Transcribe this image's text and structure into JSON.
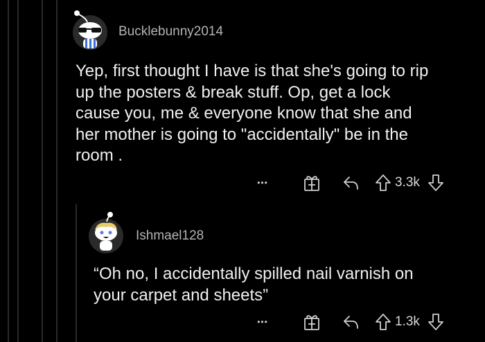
{
  "comments": [
    {
      "username": "Bucklebunny2014",
      "body": "Yep, first thought I have is that she's going to rip\nup the posters & break stuff. Op, get a lock\ncause you, me & everyone know that she and\nher mother is going to \"accidentally\" be in the\nroom .",
      "more_label": "•••",
      "vote_count": "3.3k"
    },
    {
      "username": "Ishmael128",
      "body": "“Oh no, I accidentally spilled nail varnish on\nyour carpet and sheets”",
      "more_label": "•••",
      "vote_count": "1.3k"
    }
  ],
  "icons": [
    "more-options-icon",
    "award-gift-icon",
    "reply-icon",
    "upvote-icon",
    "downvote-icon"
  ],
  "colors": {
    "background": "#000000",
    "text": "#f0f0f0",
    "muted": "#b4b4b4",
    "thread_line": "#2a2a2a"
  }
}
